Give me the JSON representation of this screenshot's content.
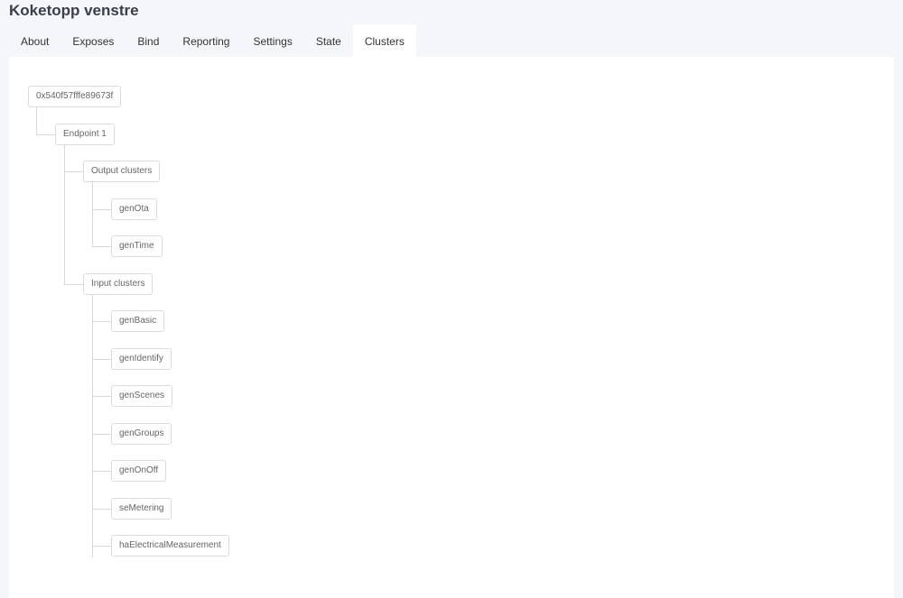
{
  "title": "Koketopp venstre",
  "tabs": [
    {
      "label": "About"
    },
    {
      "label": "Exposes"
    },
    {
      "label": "Bind"
    },
    {
      "label": "Reporting"
    },
    {
      "label": "Settings"
    },
    {
      "label": "State"
    },
    {
      "label": "Clusters",
      "active": true
    }
  ],
  "tree": {
    "root": "0x540f57fffe89673f",
    "endpoint": "Endpoint 1",
    "output_label": "Output clusters",
    "output": [
      "genOta",
      "genTime"
    ],
    "input_label": "Input clusters",
    "input": [
      "genBasic",
      "genIdentify",
      "genScenes",
      "genGroups",
      "genOnOff",
      "seMetering",
      "haElectricalMeasurement"
    ]
  }
}
